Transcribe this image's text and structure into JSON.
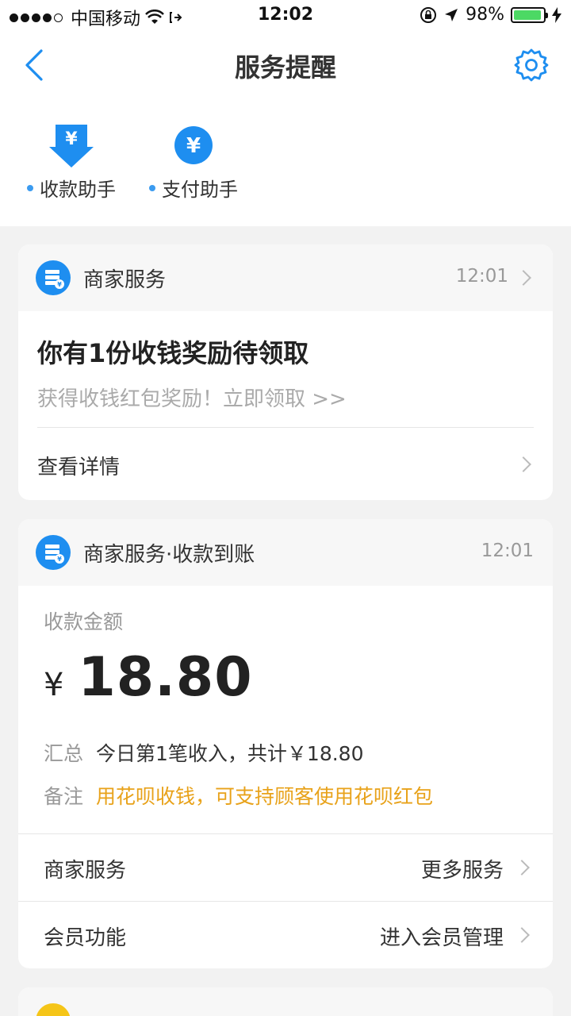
{
  "status_bar": {
    "carrier": "中国移动",
    "time": "12:02",
    "battery": "98%",
    "battery_level": 0.98
  },
  "nav": {
    "title": "服务提醒"
  },
  "assistants": [
    {
      "label": "收款助手",
      "icon": "receive-money-icon"
    },
    {
      "label": "支付助手",
      "icon": "pay-yen-icon"
    }
  ],
  "cards": [
    {
      "service_name": "商家服务",
      "time": "12:01",
      "title": "你有1份收钱奖励待领取",
      "subtitle": "获得收钱红包奖励！立即领取 >>",
      "detail_label": "查看详情"
    },
    {
      "service_name": "商家服务·收款到账",
      "time": "12:01",
      "amount_label": "收款金额",
      "currency": "¥",
      "amount": "18.80",
      "summary_key": "汇总",
      "summary_value": "今日第1笔收入，共计￥18.80",
      "remark_key": "备注",
      "remark_value": "用花呗收钱，可支持顾客使用花呗红包",
      "rows": [
        {
          "left": "商家服务",
          "right": "更多服务"
        },
        {
          "left": "会员功能",
          "right": "进入会员管理"
        }
      ]
    }
  ],
  "colors": {
    "accent": "#1e8ef0",
    "orange": "#e8a21a",
    "background": "#f2f2f2"
  }
}
